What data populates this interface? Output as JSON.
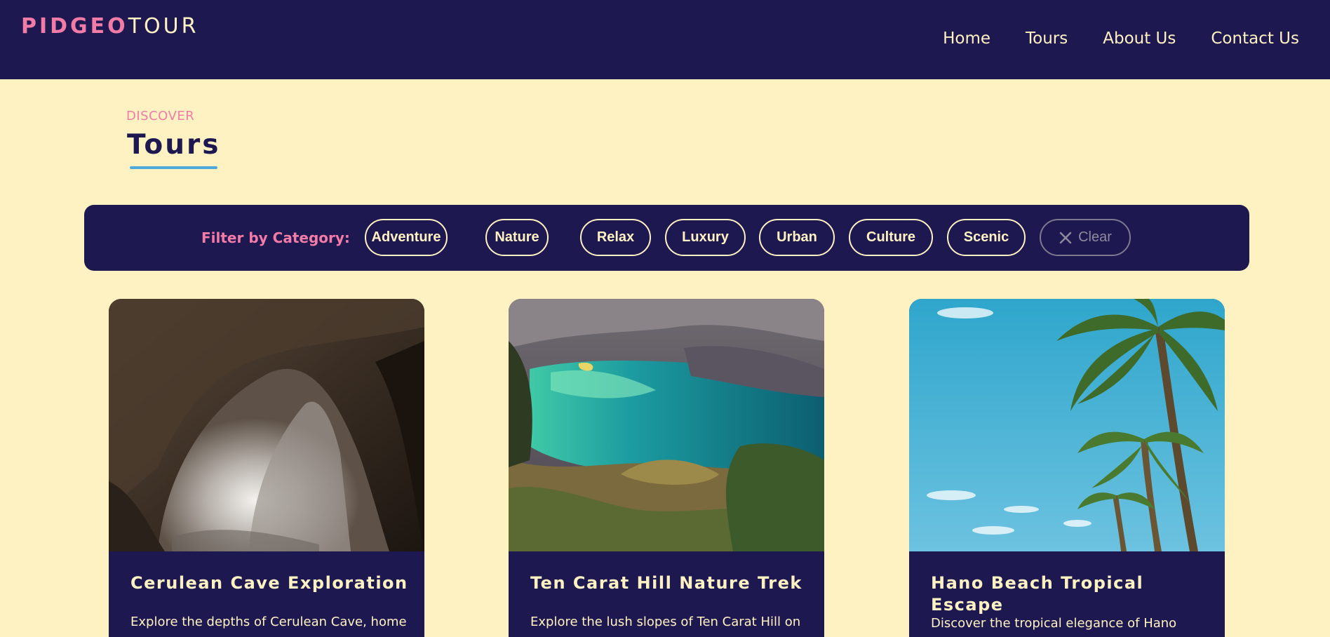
{
  "header": {
    "logo_part1": "PIDGEO",
    "logo_part2": "TOUR",
    "nav": [
      "Home",
      "Tours",
      "About Us",
      "Contact Us"
    ]
  },
  "page": {
    "eyebrow": "DISCOVER",
    "title": "Tours"
  },
  "filter": {
    "label": "Filter by Category:",
    "categories": [
      "Adventure",
      "Nature",
      "Relax",
      "Luxury",
      "Urban",
      "Culture",
      "Scenic"
    ],
    "clear_label": "Clear"
  },
  "tours": [
    {
      "title": "Cerulean Cave Exploration",
      "description": "Explore the depths of Cerulean Cave, home",
      "image": "cave-interior-photo"
    },
    {
      "title": "Ten Carat Hill Nature Trek",
      "description": "Explore the lush slopes of Ten Carat Hill on",
      "image": "turquoise-crater-lake-photo"
    },
    {
      "title": "Hano Beach Tropical Escape",
      "description": "Discover the tropical elegance of Hano",
      "image": "palm-trees-blue-sky-photo"
    }
  ],
  "colors": {
    "navy": "#1e1850",
    "cream": "#fff2c2",
    "pink": "#f27ba8",
    "underline_blue": "#4fa8dc"
  }
}
